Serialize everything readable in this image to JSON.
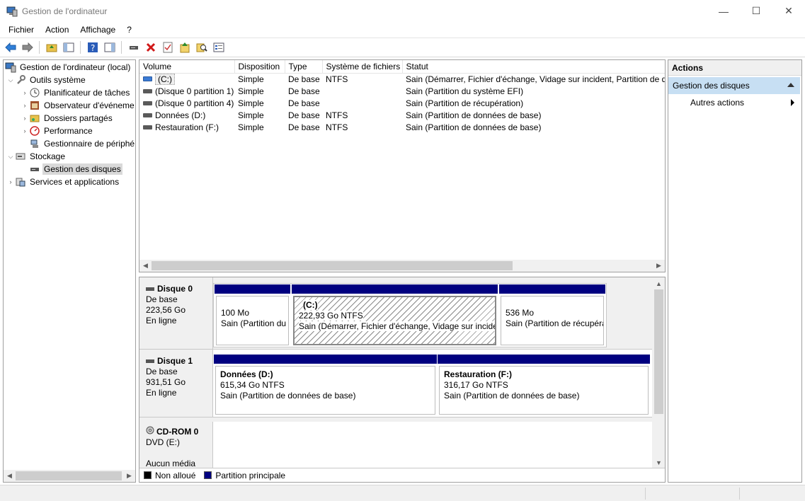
{
  "window": {
    "title": "Gestion de l'ordinateur",
    "minimize": "—",
    "maximize": "☐",
    "close": "✕"
  },
  "menu": [
    {
      "label": "Fichier"
    },
    {
      "label": "Action"
    },
    {
      "label": "Affichage"
    },
    {
      "label": "?"
    }
  ],
  "tree": {
    "root": "Gestion de l'ordinateur (local)",
    "outils": "Outils système",
    "planificateur": "Planificateur de tâches",
    "observateur": "Observateur d'événeme",
    "dossiers": "Dossiers partagés",
    "performance": "Performance",
    "gestionnaire": "Gestionnaire de périphé",
    "stockage": "Stockage",
    "gestion_disques": "Gestion des disques",
    "services": "Services et applications"
  },
  "volumes": {
    "headers": [
      "Volume",
      "Disposition",
      "Type",
      "Système de fichiers",
      "Statut"
    ],
    "rows": [
      {
        "volume": "(C:)",
        "disposition": "Simple",
        "type": "De base",
        "fs": "NTFS",
        "statut": "Sain (Démarrer, Fichier d'échange, Vidage sur incident, Partition de do"
      },
      {
        "volume": "(Disque 0 partition 1)",
        "disposition": "Simple",
        "type": "De base",
        "fs": "",
        "statut": "Sain (Partition du système EFI)"
      },
      {
        "volume": "(Disque 0 partition 4)",
        "disposition": "Simple",
        "type": "De base",
        "fs": "",
        "statut": "Sain (Partition de récupération)"
      },
      {
        "volume": "Données (D:)",
        "disposition": "Simple",
        "type": "De base",
        "fs": "NTFS",
        "statut": "Sain (Partition de données de base)"
      },
      {
        "volume": "Restauration (F:)",
        "disposition": "Simple",
        "type": "De base",
        "fs": "NTFS",
        "statut": "Sain (Partition de données de base)"
      }
    ]
  },
  "disks": {
    "disk0": {
      "name": "Disque 0",
      "type": "De base",
      "size": "223,56 Go",
      "status": "En ligne",
      "p1": {
        "size": "100 Mo",
        "status": "Sain (Partition du"
      },
      "p2": {
        "label": "(C:)",
        "size": "222,93 Go NTFS",
        "status": "Sain (Démarrer, Fichier d'échange, Vidage sur incider"
      },
      "p3": {
        "size": "536 Mo",
        "status": "Sain (Partition de récupéra"
      }
    },
    "disk1": {
      "name": "Disque 1",
      "type": "De base",
      "size": "931,51 Go",
      "status": "En ligne",
      "p1": {
        "label": "Données  (D:)",
        "size": "615,34 Go NTFS",
        "status": "Sain (Partition de données de base)"
      },
      "p2": {
        "label": "Restauration  (F:)",
        "size": "316,17 Go NTFS",
        "status": "Sain (Partition de données de base)"
      }
    },
    "cdrom": {
      "name": "CD-ROM 0",
      "type": "DVD (E:)",
      "status": "Aucun média"
    }
  },
  "legend": {
    "unallocated": "Non alloué",
    "primary": "Partition principale"
  },
  "actions": {
    "header": "Actions",
    "section": "Gestion des disques",
    "more": "Autres actions"
  },
  "colors": {
    "primary_partition": "#000080",
    "selection": "#c7dff3"
  }
}
